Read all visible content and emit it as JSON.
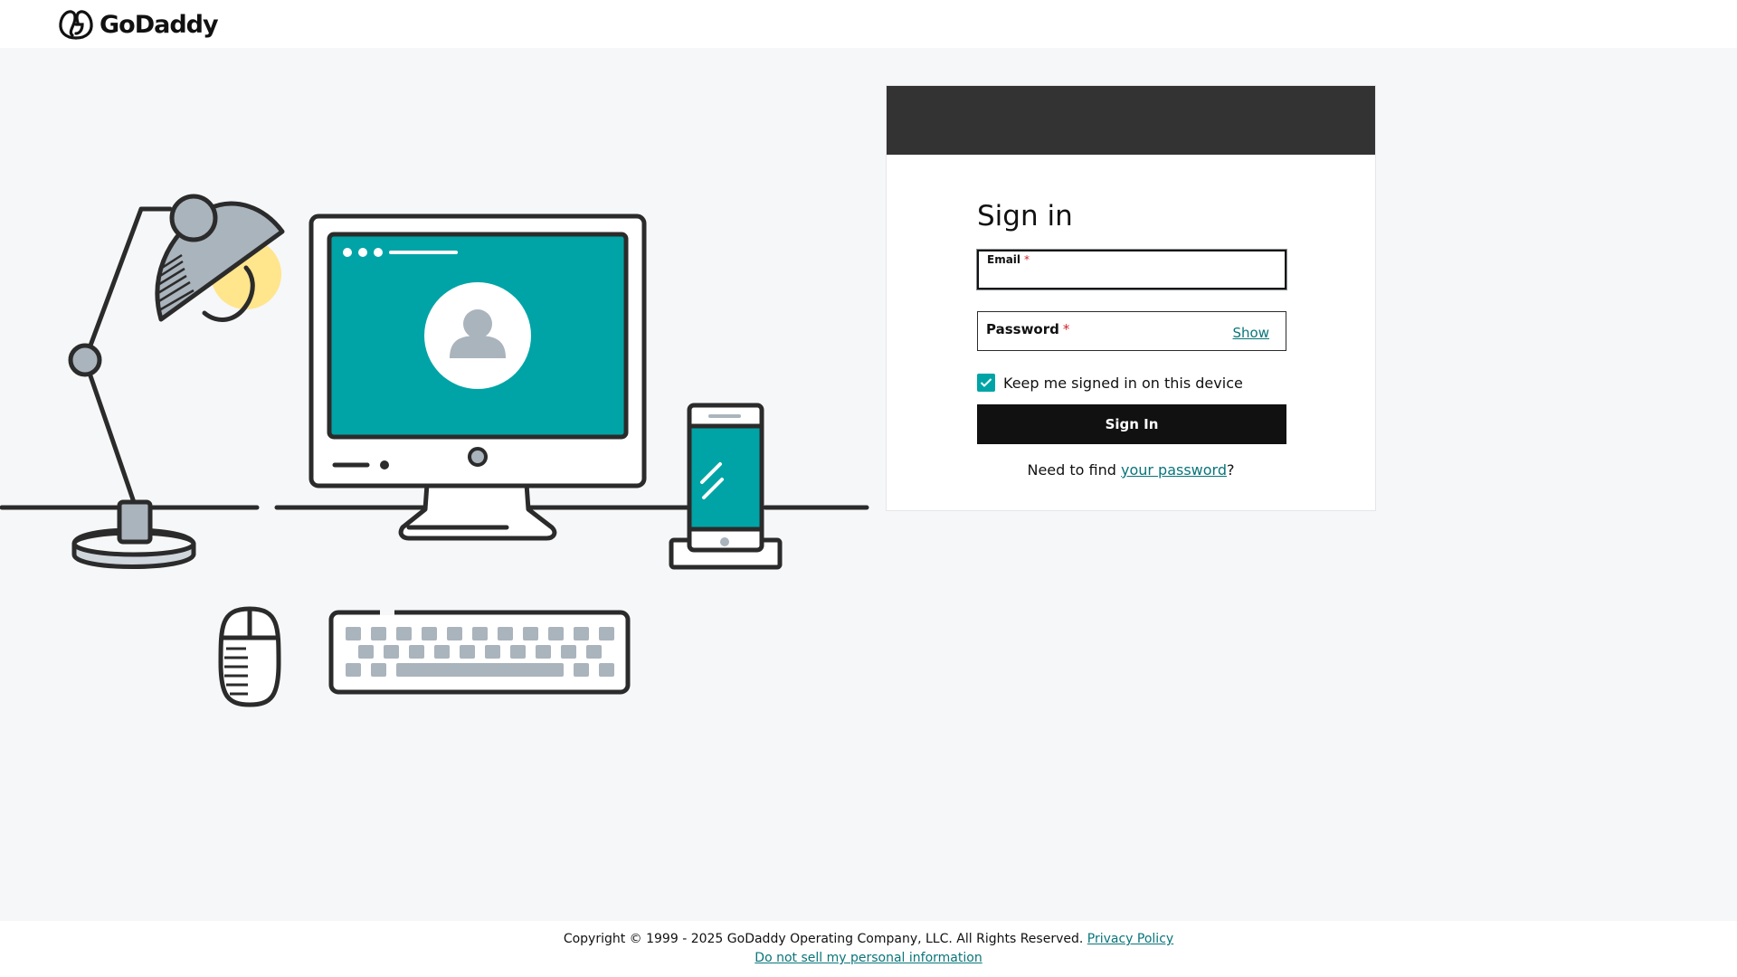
{
  "header": {
    "brand": "GoDaddy",
    "logo_icon": "godaddy-logo-icon"
  },
  "signin": {
    "title": "Sign in",
    "email": {
      "label": "Email",
      "required_marker": "*",
      "value": ""
    },
    "password": {
      "label": "Password",
      "required_marker": "*",
      "value": "",
      "show_label": "Show"
    },
    "keep_signed_in": {
      "label": "Keep me signed in on this device",
      "checked": true
    },
    "submit_label": "Sign In",
    "help": {
      "prefix": "Need to find ",
      "link_text": "your password",
      "suffix": "?"
    }
  },
  "footer": {
    "copyright": "Copyright © 1999 - 2025 GoDaddy Operating Company, LLC. All Rights Reserved.",
    "privacy_link": "Privacy Policy",
    "do_not_sell_link": "Do not sell my personal information"
  },
  "colors": {
    "accent": "#00a4a6",
    "link": "#09757a",
    "banner": "#333333",
    "button": "#111111",
    "required": "#d1232a"
  }
}
